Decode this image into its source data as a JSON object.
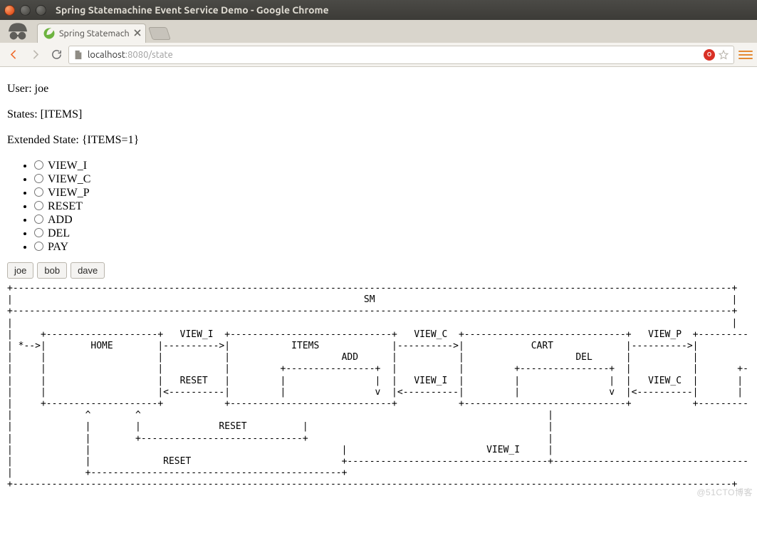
{
  "window": {
    "title": "Spring Statemachine Event Service Demo - Google Chrome"
  },
  "tabstrip": {
    "tabs": [
      {
        "label": "Spring Statemach"
      }
    ]
  },
  "toolbar": {
    "omnibox": {
      "host": "localhost",
      "port_path": ":8080/state"
    },
    "abp_label": "O"
  },
  "content": {
    "user_line": "User: joe",
    "states_line": "States: [ITEMS]",
    "ext_state_line": "Extended State: {ITEMS=1}",
    "events": [
      {
        "label": "VIEW_I"
      },
      {
        "label": "VIEW_C"
      },
      {
        "label": "VIEW_P"
      },
      {
        "label": "RESET"
      },
      {
        "label": "ADD"
      },
      {
        "label": "DEL"
      },
      {
        "label": "PAY"
      }
    ],
    "users": [
      {
        "label": "joe"
      },
      {
        "label": "bob"
      },
      {
        "label": "dave"
      }
    ],
    "diagram": "+---------------------------------------------------------------------------------------------------------------------------------+\n|                                                               SM                                                                |\n+---------------------------------------------------------------------------------------------------------------------------------+\n|                                                                                                                                 |\n|     +--------------------+   VIEW_I  +-----------------------------+   VIEW_C  +-----------------------------+   VIEW_P  +---------------------------+\n| *-->|        HOME        |---------->|           ITEMS             |---------->|            CART             |---------->|          PAYMENT          |\n|     |                    |           |                    ADD      |           |                    DEL      |           |                    PAY    |\n|     |                    |           |         +----------------+  |           |         +----------------+  |           |       +----------------+  |\n|     |                    |   RESET   |         |                |  |   VIEW_I  |         |                |  |   VIEW_C  |       |                |  |\n|     |                    |<----------|         |                v  |<----------|         |                v  |<----------|       |                v  |\n|     +--------------------+           +-----------------------------+           +-----------------------------+           +---------------------------+\n|             ^        ^                                                                         |                                            |          |\n|             |        |              RESET          |                                           |                                            |          |\n|             |        +-----------------------------+                                           |                                            |          |\n|             |                                             |                         VIEW_I     |                                            |          |\n|             |             RESET                           +------------------------------------+--------------------------------------------+          |\n|             +---------------------------------------------+                                                                                            |\n+---------------------------------------------------------------------------------------------------------------------------------+"
  },
  "watermark": "@51CTO博客"
}
